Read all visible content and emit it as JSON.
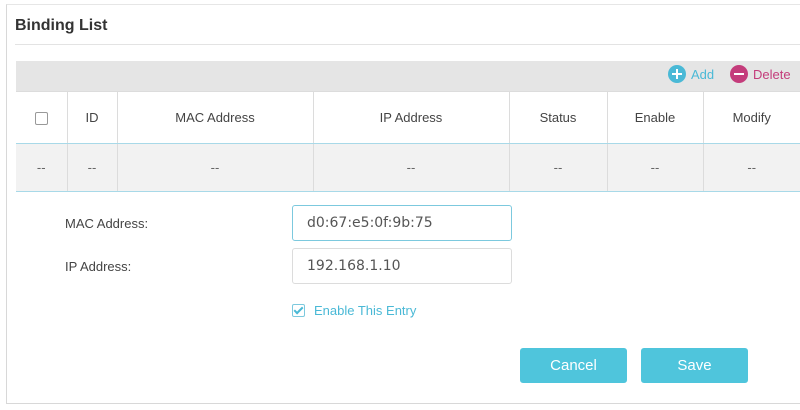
{
  "section": {
    "title": "Binding List"
  },
  "toolbar": {
    "add_label": "Add",
    "delete_label": "Delete"
  },
  "table": {
    "columns": [
      "ID",
      "MAC Address",
      "IP Address",
      "Status",
      "Enable",
      "Modify"
    ],
    "rows": [
      {
        "select": "--",
        "id": "--",
        "mac": "--",
        "ip": "--",
        "status": "--",
        "enable": "--",
        "modify": "--"
      }
    ]
  },
  "form": {
    "mac_label": "MAC Address:",
    "mac_value": "d0:67:e5:0f:9b:75",
    "ip_label": "IP Address:",
    "ip_value": "192.168.1.10",
    "enable_label": "Enable This Entry",
    "enable_checked": true,
    "cancel_label": "Cancel",
    "save_label": "Save"
  },
  "colors": {
    "accent": "#4fc5dc",
    "delete": "#c43c7b",
    "toolbar_bg": "#e5e5e5"
  },
  "icons": {
    "add": "plus-circle-icon",
    "delete": "minus-circle-icon",
    "enable": "checkbox-checked-icon"
  }
}
